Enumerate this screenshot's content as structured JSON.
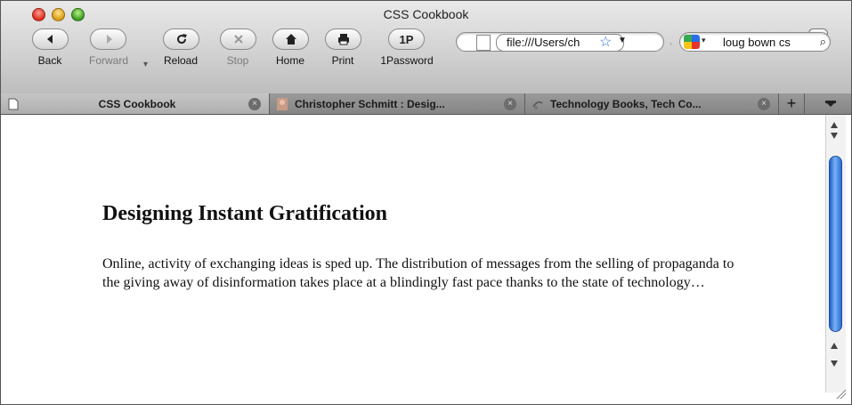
{
  "window": {
    "title": "CSS Cookbook"
  },
  "toolbar": {
    "back_label": "Back",
    "forward_label": "Forward",
    "reload_label": "Reload",
    "stop_label": "Stop",
    "home_label": "Home",
    "print_label": "Print",
    "onepassword_label": "1Password",
    "onepassword_button_text": "1P"
  },
  "address_bar": {
    "value": "file:///Users/ch"
  },
  "search_bar": {
    "value": "loug bown cs"
  },
  "tabs": [
    {
      "label": "CSS Cookbook",
      "active": true
    },
    {
      "label": "Christopher Schmitt : Desig...",
      "active": false
    },
    {
      "label": "Technology Books, Tech Co...",
      "active": false
    }
  ],
  "new_tab_label": "+",
  "page": {
    "heading": "Designing Instant Gratification",
    "body": "Online, activity of exchanging ideas is sped up. The distribution of messages from the selling of propaganda to the giving away of disinformation takes place at a blindingly fast pace thanks to the state of technology…"
  }
}
